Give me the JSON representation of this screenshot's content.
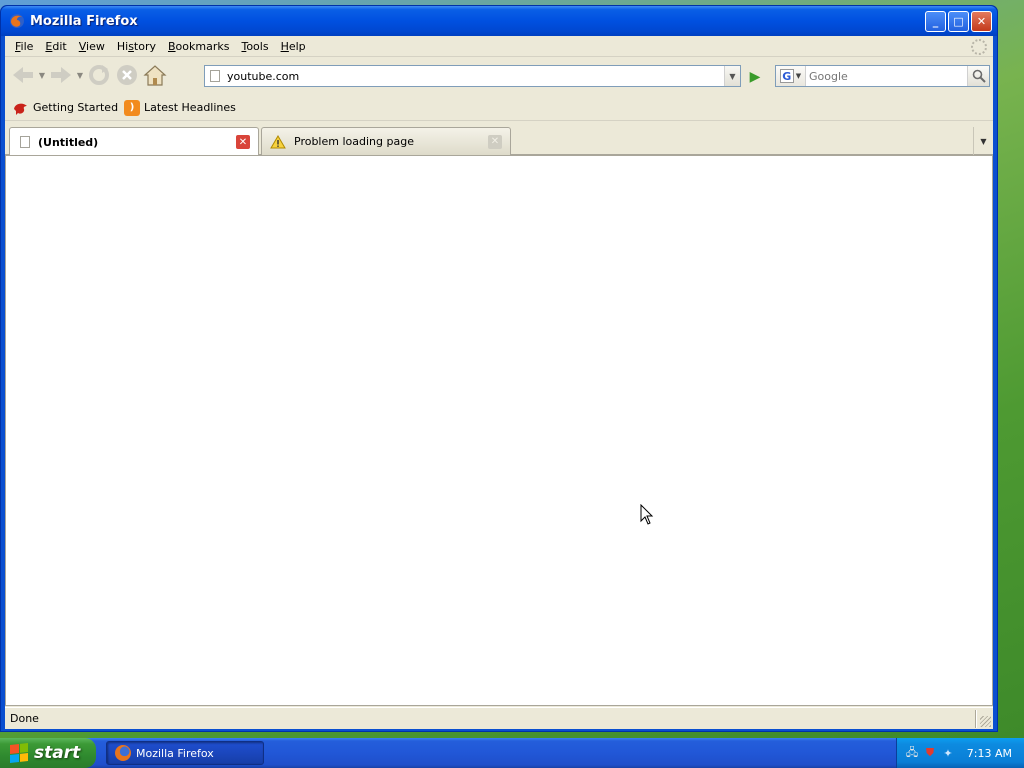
{
  "window": {
    "title": "Mozilla Firefox",
    "controls": {
      "minimize": "_",
      "maximize": "□",
      "close": "✕"
    }
  },
  "menubar": {
    "items": [
      {
        "key": "F",
        "rest": "ile"
      },
      {
        "key": "E",
        "rest": "dit"
      },
      {
        "key": "V",
        "rest": "iew"
      },
      {
        "key": "",
        "rest": "History",
        "underline_index": 2
      },
      {
        "key": "B",
        "rest": "ookmarks"
      },
      {
        "key": "T",
        "rest": "ools"
      },
      {
        "key": "H",
        "rest": "elp"
      }
    ]
  },
  "navbar": {
    "back_icon": "back-arrow-icon",
    "forward_icon": "forward-arrow-icon",
    "reload_icon": "reload-icon",
    "stop_icon": "stop-icon",
    "home_icon": "home-icon",
    "url": "youtube.com",
    "search": {
      "engine": "G",
      "placeholder": "Google"
    }
  },
  "bookmarks": {
    "items": [
      {
        "label": "Getting Started",
        "icon": "firefox-bookmark-icon"
      },
      {
        "label": "Latest Headlines",
        "icon": "rss-icon"
      }
    ]
  },
  "tabs": [
    {
      "label": "(Untitled)",
      "active": true
    },
    {
      "label": "Problem loading page",
      "active": false
    }
  ],
  "statusbar": {
    "text": "Done"
  },
  "taskbar": {
    "start_label": "start",
    "tasks": [
      {
        "label": "Mozilla Firefox"
      }
    ],
    "clock": "7:13 AM"
  },
  "colors": {
    "titlebar": "#0050e0",
    "chrome": "#ece9d8",
    "taskbar": "#245edb",
    "start": "#3c9a36"
  }
}
